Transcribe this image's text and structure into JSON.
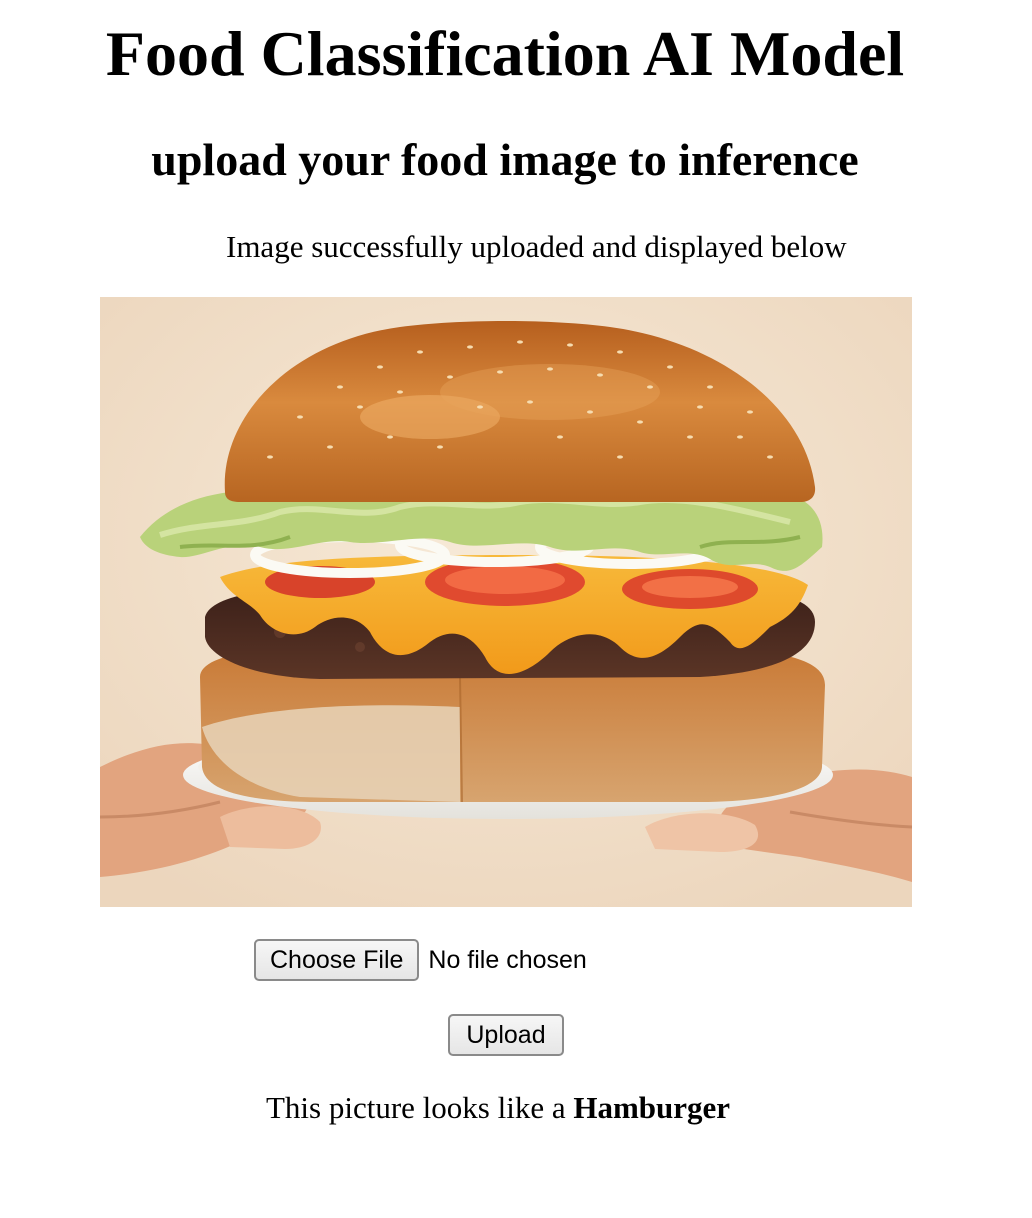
{
  "header": {
    "title": "Food Classification AI Model",
    "subtitle": "upload your food image to inference"
  },
  "status": {
    "message": "Image successfully uploaded and displayed below"
  },
  "uploaded_image": {
    "depicts": "hamburger",
    "colors": {
      "background": "#f3e4d0",
      "bun": "#c8762f",
      "lettuce": "#b9d27a",
      "cheese": "#f4a21f",
      "patty": "#4a2c22",
      "tomato": "#e04a2f",
      "plate": "#f7f5f0",
      "hand": "#e7b08f"
    }
  },
  "form": {
    "choose_file_label": "Choose File",
    "file_status": "No file chosen",
    "upload_label": "Upload"
  },
  "result": {
    "prefix": "This picture looks like a ",
    "label": "Hamburger"
  }
}
